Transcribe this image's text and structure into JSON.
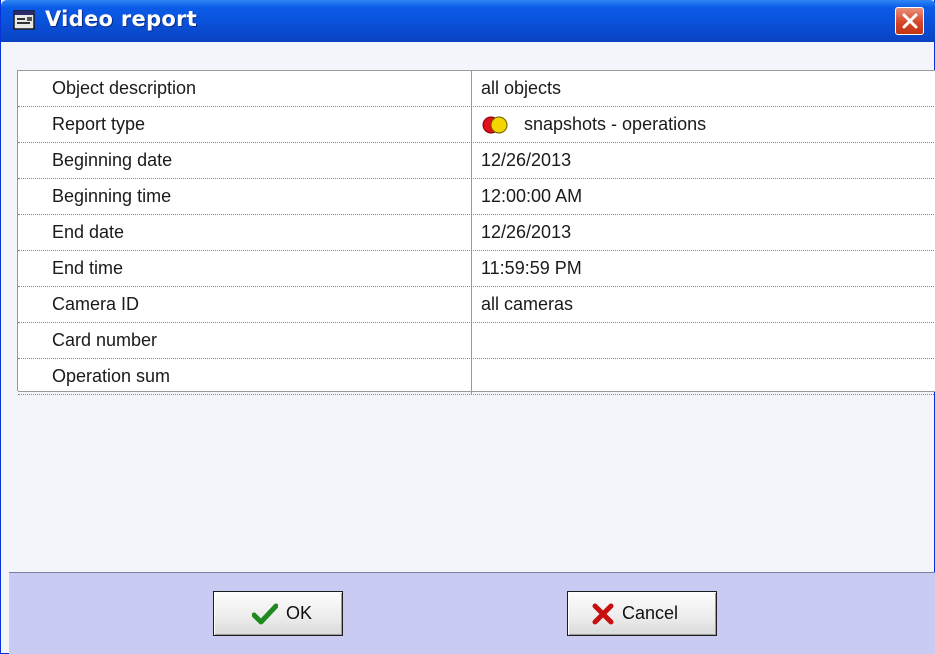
{
  "window": {
    "title": "Video report",
    "title_icon": "report-window-icon",
    "close_icon": "close-icon"
  },
  "properties": [
    {
      "label": "Object description",
      "value": "all objects"
    },
    {
      "label": "Report type",
      "value": "snapshots - operations",
      "icon": "red-yellow-circles-icon"
    },
    {
      "label": "Beginning date",
      "value": "12/26/2013"
    },
    {
      "label": "Beginning time",
      "value": "12:00:00 AM"
    },
    {
      "label": "End date",
      "value": "12/26/2013"
    },
    {
      "label": "End time",
      "value": "11:59:59 PM"
    },
    {
      "label": "Camera ID",
      "value": "all cameras"
    },
    {
      "label": "Card number",
      "value": ""
    },
    {
      "label": "Operation sum",
      "value": ""
    }
  ],
  "buttons": {
    "ok": {
      "label": "OK",
      "icon": "checkmark-icon"
    },
    "cancel": {
      "label": "Cancel",
      "icon": "red-x-icon"
    }
  },
  "colors": {
    "titlebar": "#0a4fd6",
    "footer": "#c9cbf2",
    "close": "#d6462a"
  }
}
